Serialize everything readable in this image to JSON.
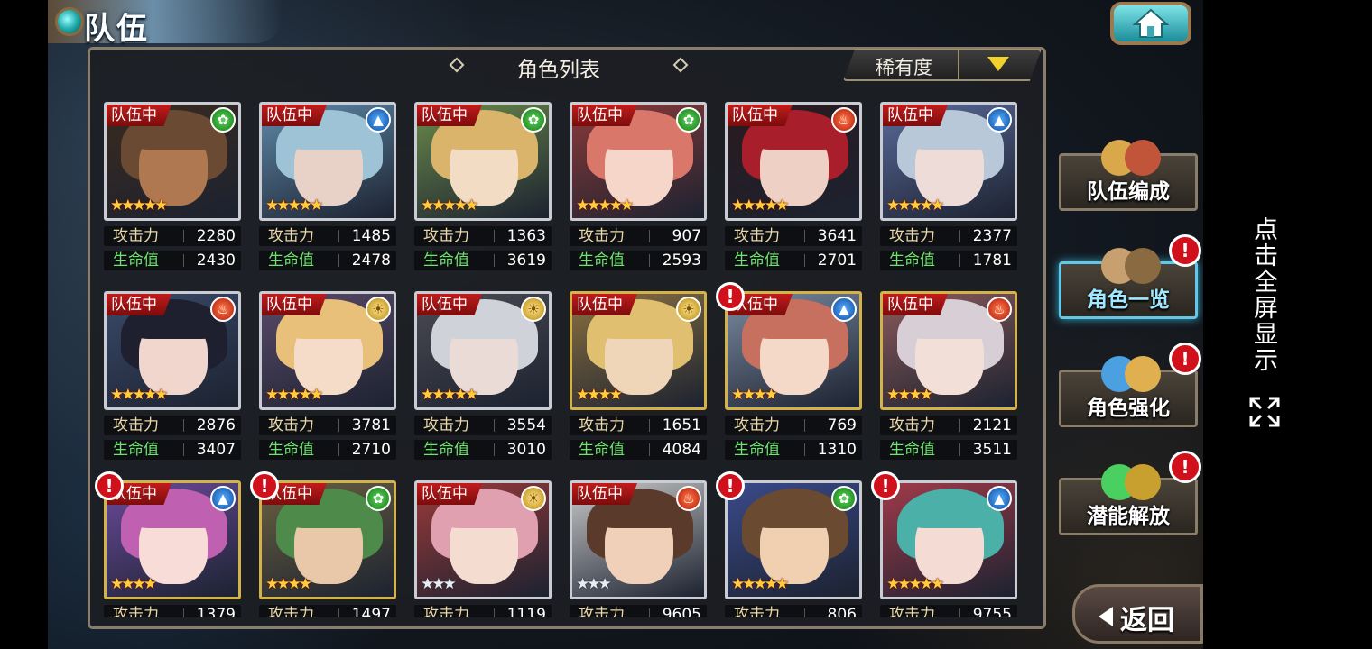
{
  "screen": {
    "title": "队伍",
    "panel_title": "角色列表",
    "sort": {
      "label": "稀有度"
    },
    "stat_labels": {
      "attack": "攻击力",
      "hp": "生命值"
    },
    "team_tag": "队伍中",
    "fullscreen_hint": "点击全屏显示",
    "back_label": "返回"
  },
  "side_menu": [
    {
      "label": "队伍编成",
      "active": false,
      "alert": false
    },
    {
      "label": "角色一览",
      "active": true,
      "alert": true
    },
    {
      "label": "角色强化",
      "active": false,
      "alert": true
    },
    {
      "label": "潜能解放",
      "active": false,
      "alert": true
    }
  ],
  "characters": [
    {
      "element": "wind",
      "stars": 5,
      "frame": "silver",
      "in_team": true,
      "alert": false,
      "attack": "2280",
      "hp": "2430",
      "palette": [
        "#6b4a33",
        "#b07850",
        "#3a2a20"
      ]
    },
    {
      "element": "water",
      "stars": 5,
      "frame": "silver",
      "in_team": true,
      "alert": false,
      "attack": "1485",
      "hp": "2478",
      "palette": [
        "#9fc3d6",
        "#e8d2c8",
        "#5e88a8"
      ]
    },
    {
      "element": "wind",
      "stars": 5,
      "frame": "silver",
      "in_team": true,
      "alert": false,
      "attack": "1363",
      "hp": "3619",
      "palette": [
        "#d9b46a",
        "#f2dcc4",
        "#6a8a4a"
      ]
    },
    {
      "element": "wind",
      "stars": 5,
      "frame": "silver",
      "in_team": true,
      "alert": false,
      "attack": "907",
      "hp": "2593",
      "palette": [
        "#d9776a",
        "#f5d6c8",
        "#8a3a3a"
      ]
    },
    {
      "element": "fire",
      "stars": 5,
      "frame": "silver",
      "in_team": true,
      "alert": false,
      "attack": "3641",
      "hp": "2701",
      "palette": [
        "#a81e2a",
        "#efd0c4",
        "#2a1a1e"
      ]
    },
    {
      "element": "water",
      "stars": 5,
      "frame": "silver",
      "in_team": true,
      "alert": false,
      "attack": "2377",
      "hp": "1781",
      "palette": [
        "#b8c8d8",
        "#eddcd8",
        "#5a6a9a"
      ]
    },
    {
      "element": "fire",
      "stars": 5,
      "frame": "silver",
      "in_team": true,
      "alert": false,
      "attack": "2876",
      "hp": "3407",
      "palette": [
        "#1e2030",
        "#f0d6cc",
        "#3a4a6a"
      ]
    },
    {
      "element": "light",
      "stars": 5,
      "frame": "silver",
      "in_team": true,
      "alert": false,
      "attack": "3781",
      "hp": "2710",
      "palette": [
        "#e8c07a",
        "#f5dcc8",
        "#5a4a6a"
      ]
    },
    {
      "element": "light",
      "stars": 5,
      "frame": "silver",
      "in_team": true,
      "alert": false,
      "attack": "3554",
      "hp": "3010",
      "palette": [
        "#cfd2d8",
        "#eadbd6",
        "#4a4a52"
      ]
    },
    {
      "element": "light",
      "stars": 4,
      "frame": "gold",
      "in_team": true,
      "alert": false,
      "attack": "1651",
      "hp": "4084",
      "palette": [
        "#e0c070",
        "#efd6b8",
        "#8a7040"
      ]
    },
    {
      "element": "water",
      "stars": 4,
      "frame": "gold",
      "in_team": true,
      "alert": true,
      "attack": "769",
      "hp": "1310",
      "palette": [
        "#c87060",
        "#f4d8c8",
        "#7a8aa0"
      ]
    },
    {
      "element": "fire",
      "stars": 4,
      "frame": "gold",
      "in_team": true,
      "alert": false,
      "attack": "2121",
      "hp": "3511",
      "palette": [
        "#d8cfd6",
        "#f2e0d8",
        "#8a5a5a"
      ]
    },
    {
      "element": "water",
      "stars": 4,
      "frame": "gold",
      "in_team": true,
      "alert": true,
      "attack": "1379",
      "hp": "",
      "palette": [
        "#c060b0",
        "#f8dcd8",
        "#6a4a9a"
      ]
    },
    {
      "element": "wind",
      "stars": 4,
      "frame": "gold",
      "in_team": true,
      "alert": true,
      "attack": "1497",
      "hp": "",
      "palette": [
        "#4e8a4a",
        "#e8c8a8",
        "#6a6040"
      ]
    },
    {
      "element": "light",
      "stars": 3,
      "frame": "silver",
      "in_team": true,
      "alert": false,
      "attack": "1119",
      "hp": "",
      "palette": [
        "#e0a0b0",
        "#f5dcd0",
        "#9a3a3a"
      ]
    },
    {
      "element": "fire",
      "stars": 3,
      "frame": "silver",
      "in_team": true,
      "alert": false,
      "attack": "9605",
      "hp": "",
      "palette": [
        "#5a3a2a",
        "#f0d0b8",
        "#c8c8c8"
      ]
    },
    {
      "element": "wind",
      "stars": 5,
      "frame": "silver",
      "in_team": false,
      "alert": true,
      "attack": "806",
      "hp": "",
      "palette": [
        "#6a4a30",
        "#f0d0b0",
        "#3a4a8a"
      ]
    },
    {
      "element": "water",
      "stars": 5,
      "frame": "silver",
      "in_team": false,
      "alert": true,
      "attack": "9755",
      "hp": "",
      "palette": [
        "#4ab0a8",
        "#f4dcd4",
        "#a03a4a"
      ]
    }
  ]
}
